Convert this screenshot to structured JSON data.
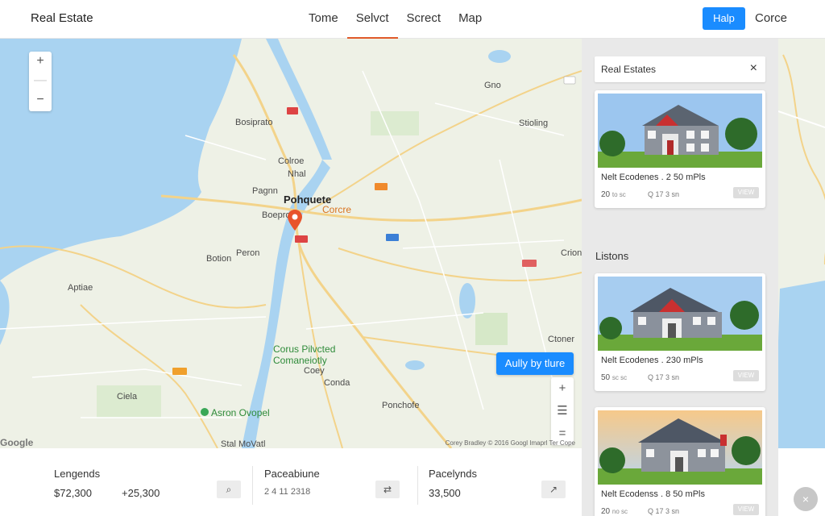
{
  "header": {
    "brand": "Real Estate",
    "tabs": [
      {
        "label": "Tome",
        "active": false
      },
      {
        "label": "Selvct",
        "active": true
      },
      {
        "label": "Screct",
        "active": false
      },
      {
        "label": "Map",
        "active": false
      }
    ],
    "help_label": "Halp",
    "cancel_label": "Corce"
  },
  "map": {
    "zoom_in": "+",
    "zoom_out": "−",
    "apply_label": "Aully by tlure",
    "credits": "Corey Bradley © 2016 Googl  Imaprl Ter  Cope",
    "google": "Google",
    "labels": [
      {
        "text": "Bosiprato"
      },
      {
        "text": "Colroe"
      },
      {
        "text": "Nhal"
      },
      {
        "text": "Pagnn"
      },
      {
        "text": "Pohquete"
      },
      {
        "text": "Boeprof"
      },
      {
        "text": "Corcre"
      },
      {
        "text": "Botion"
      },
      {
        "text": "Peron"
      },
      {
        "text": "Aptiae"
      },
      {
        "text": "Stioling"
      },
      {
        "text": "Gno"
      },
      {
        "text": "Ctoner"
      },
      {
        "text": "Corus Pilvcted"
      },
      {
        "text": "Comaneiotly"
      },
      {
        "text": "Coey"
      },
      {
        "text": "Ciela"
      },
      {
        "text": "Conda"
      },
      {
        "text": "Asron Ovopel"
      },
      {
        "text": "Ponchofe"
      },
      {
        "text": "Stal MoVatl"
      },
      {
        "text": "Crion"
      }
    ]
  },
  "panel": {
    "search_text": "Real Estates",
    "close_icon": "×",
    "section_title": "Listons",
    "listings": [
      {
        "title": "Nelt Ecodenes . 2 50 mPls",
        "beds": "20",
        "beds_unit": "to sc",
        "meta": "Q 17 3 sn",
        "view": "VIEW"
      },
      {
        "title": "Nelt Ecodenes . 230 mPls",
        "beds": "50",
        "beds_unit": "sc sc",
        "meta": "Q 17 3 sn",
        "view": "VIEW"
      },
      {
        "title": "Nelt Ecodenss . 8 50 mPls",
        "beds": "20",
        "beds_unit": "no sc",
        "meta": "Q 17 3 sn",
        "view": "VIEW"
      }
    ]
  },
  "bottom": {
    "cols": [
      {
        "heading": "Lengends",
        "value1": "$72,300",
        "value2": "+25,300",
        "icon": "⌕"
      },
      {
        "heading": "Paceabiune",
        "value1": "2 4 11 2318",
        "icon": "⇄"
      },
      {
        "heading": "Pacelynds",
        "value1": "33,500",
        "icon": "↗"
      }
    ]
  },
  "fab_icon": "×",
  "colors": {
    "accent": "#1a8cff",
    "active_tab": "#e05a2a",
    "water": "#a9d3f1",
    "land": "#eef1e6"
  }
}
